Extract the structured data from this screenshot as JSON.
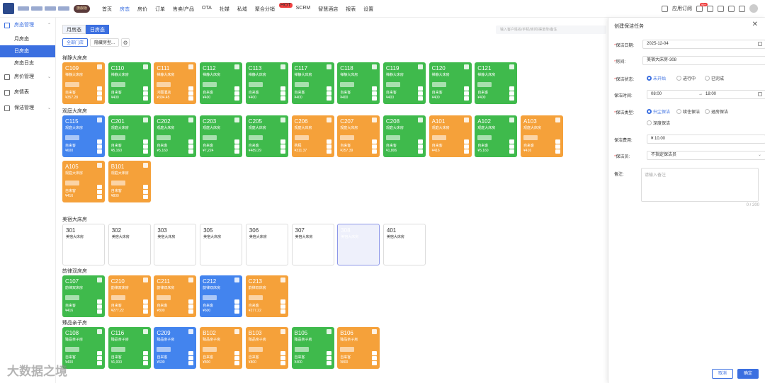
{
  "top_nav": [
    "首页",
    "房态",
    "房价",
    "订单",
    "售卖/产品",
    "OTA",
    "社媒",
    "私域",
    "聚合分销",
    "SCRM",
    "智慧酒店",
    "报表",
    "设置"
  ],
  "top_nav_active": "房态",
  "top_nav_hot": "HOT",
  "vip_badge": "旗舰版",
  "top_right": {
    "subscription": "应用订阅",
    "badge": "99+"
  },
  "sidebar": [
    {
      "label": "房态管理",
      "expanded": true,
      "active": true,
      "children": [
        "月房态",
        "日房态",
        "房态日志"
      ],
      "active_child": "日房态"
    },
    {
      "label": "房价管理",
      "expanded": false,
      "children": []
    },
    {
      "label": "房情表",
      "expanded": false,
      "children": []
    },
    {
      "label": "保洁管理",
      "expanded": false,
      "children": []
    }
  ],
  "toggle": {
    "month": "月房态",
    "day": "日房态"
  },
  "search_placeholder": "输入客户姓名/手机/房间/渠道单/备注",
  "filters": {
    "all": "全部门店",
    "hide": "隐藏房型..."
  },
  "sections": [
    {
      "label": "禅静大床房",
      "rooms": [
        {
          "no": "C109",
          "type": "禅静大床房",
          "color": "orange",
          "source": "自来客",
          "price": "¥357.28"
        },
        {
          "no": "C110",
          "type": "禅静大床房",
          "color": "green",
          "source": "自来客",
          "price": "¥400"
        },
        {
          "no": "C111",
          "type": "禅静大床房",
          "color": "orange",
          "source": "鸿图酒店",
          "price": "¥394.45"
        },
        {
          "no": "C112",
          "type": "禅静大床房",
          "color": "green",
          "source": "自来客",
          "price": "¥400"
        },
        {
          "no": "C113",
          "type": "禅静大床房",
          "color": "green",
          "source": "自来客",
          "price": "¥400"
        },
        {
          "no": "C117",
          "type": "禅静大床房",
          "color": "green",
          "source": "自来客",
          "price": "¥400"
        },
        {
          "no": "C118",
          "type": "禅静大床房",
          "color": "green",
          "source": "自来客",
          "price": "¥400"
        },
        {
          "no": "C119",
          "type": "禅静大床房",
          "color": "green",
          "source": "自来客",
          "price": "¥400"
        },
        {
          "no": "C120",
          "type": "禅静大床房",
          "color": "green",
          "source": "自来客",
          "price": "¥400"
        },
        {
          "no": "C121",
          "type": "禅静大床房",
          "color": "green",
          "source": "自来客",
          "price": "¥400"
        }
      ]
    },
    {
      "label": "观庭大床房",
      "rooms": [
        {
          "no": "C115",
          "type": "观庭大床房",
          "color": "blue",
          "source": "自来客",
          "price": "¥600"
        },
        {
          "no": "C201",
          "type": "观庭大床房",
          "color": "green",
          "source": "自来客",
          "price": "¥5,160"
        },
        {
          "no": "C202",
          "type": "观庭大床房",
          "color": "green",
          "source": "自来客",
          "price": "¥5,160"
        },
        {
          "no": "C203",
          "type": "观庭大床房",
          "color": "green",
          "source": "自来客",
          "price": "¥7,224"
        },
        {
          "no": "C205",
          "type": "观庭大床房",
          "color": "green",
          "source": "自来客",
          "price": "¥489.29"
        },
        {
          "no": "C206",
          "type": "观庭大床房",
          "color": "orange",
          "source": "携程",
          "price": "¥311.37"
        },
        {
          "no": "C207",
          "type": "观庭大床房",
          "color": "orange",
          "source": "自来客",
          "price": "¥257.39"
        },
        {
          "no": "C208",
          "type": "观庭大床房",
          "color": "green",
          "source": "自来客",
          "price": "¥1,806"
        },
        {
          "no": "A101",
          "type": "观庭大床房",
          "color": "orange",
          "source": "自来客",
          "price": "¥416"
        },
        {
          "no": "A102",
          "type": "观庭大床房",
          "color": "green",
          "source": "自来客",
          "price": "¥5,160"
        },
        {
          "no": "A103",
          "type": "观庭大床房",
          "color": "orange",
          "source": "自来客",
          "price": "¥416"
        },
        {
          "no": "A105",
          "type": "观庭大床房",
          "color": "orange",
          "source": "自来客",
          "price": "¥416"
        },
        {
          "no": "B101",
          "type": "观庭大床房",
          "color": "orange",
          "source": "自来客",
          "price": "¥800"
        }
      ]
    },
    {
      "label": "美宿大床房",
      "rooms": [
        {
          "no": "301",
          "type": "美宿大床房",
          "color": "white"
        },
        {
          "no": "302",
          "type": "美宿大床房",
          "color": "white"
        },
        {
          "no": "303",
          "type": "美宿大床房",
          "color": "white"
        },
        {
          "no": "305",
          "type": "美宿大床房",
          "color": "white"
        },
        {
          "no": "306",
          "type": "美宿大床房",
          "color": "white"
        },
        {
          "no": "307",
          "type": "美宿大床房",
          "color": "white"
        },
        {
          "no": "308",
          "type": "美宿大床房",
          "color": "selected"
        },
        {
          "no": "401",
          "type": "美宿大床房",
          "color": "white"
        }
      ]
    },
    {
      "label": "韵律双床房",
      "rooms": [
        {
          "no": "C107",
          "type": "韵律双床房",
          "color": "green",
          "source": "自来客",
          "price": "¥416"
        },
        {
          "no": "C210",
          "type": "韵律双床房",
          "color": "orange",
          "source": "自来客",
          "price": "¥277.22"
        },
        {
          "no": "C211",
          "type": "韵律双床房",
          "color": "orange",
          "source": "自来客",
          "price": "¥800"
        },
        {
          "no": "C212",
          "type": "韵律双床房",
          "color": "blue",
          "source": "自来客",
          "price": "¥600"
        },
        {
          "no": "C213",
          "type": "韵律双床房",
          "color": "orange",
          "source": "自来客",
          "price": "¥277.22"
        }
      ]
    },
    {
      "label": "臻品亲子房",
      "rooms": [
        {
          "no": "C108",
          "type": "臻品亲子房",
          "color": "green",
          "source": "自来客",
          "price": "¥400"
        },
        {
          "no": "C116",
          "type": "臻品亲子房",
          "color": "green",
          "source": "自来客",
          "price": "¥1,000"
        },
        {
          "no": "C209",
          "type": "臻品亲子房",
          "color": "blue",
          "source": "自来客",
          "price": "¥600"
        },
        {
          "no": "B102",
          "type": "臻品亲子房",
          "color": "orange",
          "source": "自来客",
          "price": "¥800"
        },
        {
          "no": "B103",
          "type": "臻品亲子房",
          "color": "orange",
          "source": "自来客",
          "price": "¥800"
        },
        {
          "no": "B105",
          "type": "臻品亲子房",
          "color": "green",
          "source": "自来客",
          "price": "¥400"
        },
        {
          "no": "B106",
          "type": "臻品亲子房",
          "color": "orange",
          "source": "自来客",
          "price": "¥800"
        }
      ]
    }
  ],
  "panel": {
    "title": "创建保洁任务",
    "date_label": "保洁日期:",
    "date": "2025-12-04",
    "room_label": "房间:",
    "room": "美宿大床房-308",
    "status_label": "保洁状态:",
    "status_options": [
      "未开始",
      "进行中",
      "已完成"
    ],
    "status_selected": 0,
    "time_label": "保洁时间:",
    "time_start": "08:00",
    "time_sep": "→",
    "time_end": "18:00",
    "type_label": "保洁类型:",
    "type_options": [
      "扫尘保洁",
      "续住保洁",
      "退房保洁",
      "深度保洁"
    ],
    "type_selected": 0,
    "fee_label": "保洁费用:",
    "fee": "¥ 10.00",
    "staff_label": "保洁员:",
    "staff": "不指定保洁员",
    "note_label": "备注:",
    "note_placeholder": "请输入备注",
    "note_count": "0 / 200",
    "cancel": "取消",
    "ok": "确定"
  },
  "watermark": "大数据之境"
}
